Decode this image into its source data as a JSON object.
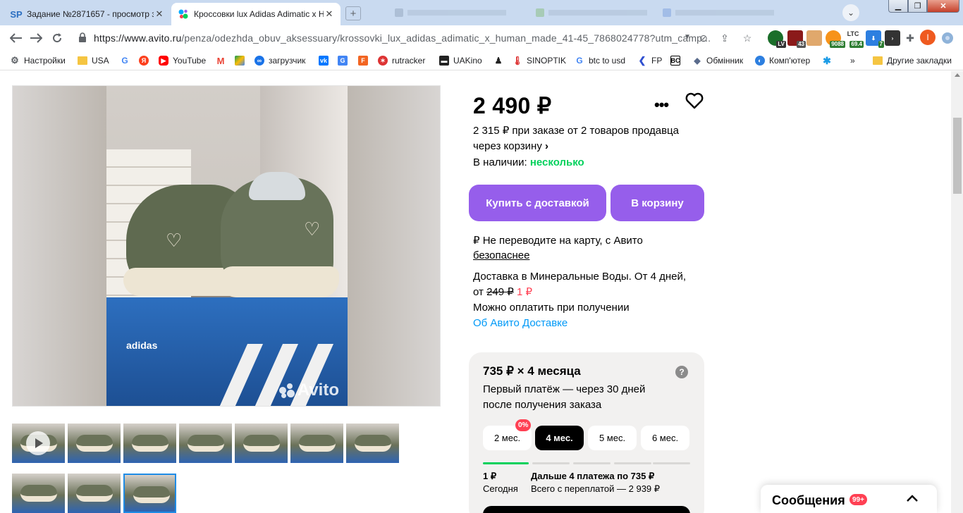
{
  "browser": {
    "tabs": [
      {
        "favicon": "SP",
        "title": "Задание №2871657 - просмотр з"
      },
      {
        "favicon": "avito-icon",
        "title": "Кроссовки lux Adidas Adimatic x H"
      }
    ],
    "url_main": "https://www.avito.ru",
    "url_rest": "/penza/odezhda_obuv_aksessuary/krossovki_lux_adidas_adimatic_x_human_made_41-45_7868024778?utm_camp...",
    "extensions": {
      "lv": "LV",
      "count43": "43",
      "btc": "9088",
      "ltc_label": "LTC",
      "ltc_value": "69.4",
      "dl": "7"
    },
    "profile_letter": "I",
    "bookmarks": [
      {
        "label": "Настройки",
        "icon": "gear-icon"
      },
      {
        "label": "USA",
        "icon": "folder-icon"
      },
      {
        "label": "",
        "icon": "google-icon"
      },
      {
        "label": "",
        "icon": "yandex-icon"
      },
      {
        "label": "YouTube",
        "icon": "youtube-icon"
      },
      {
        "label": "",
        "icon": "gmail-icon"
      },
      {
        "label": "",
        "icon": "drive-icon"
      },
      {
        "label": "загрузчик",
        "icon": "loader-icon"
      },
      {
        "label": "",
        "icon": "vk-icon"
      },
      {
        "label": "",
        "icon": "translate-icon"
      },
      {
        "label": "",
        "icon": "fcorp-icon"
      },
      {
        "label": "rutracker",
        "icon": "rutracker-icon"
      },
      {
        "label": "UAKino",
        "icon": "uakino-icon"
      },
      {
        "label": "",
        "icon": "user-icon"
      },
      {
        "label": "SINOPTIK",
        "icon": "thermometer-icon"
      },
      {
        "label": "btc to usd",
        "icon": "google-icon"
      },
      {
        "label": "FP",
        "icon": "fp-icon"
      },
      {
        "label": "",
        "icon": "bc-icon"
      },
      {
        "label": "Обмінник",
        "icon": "exchange-icon"
      },
      {
        "label": "Комп'ютер",
        "icon": "computer-icon"
      },
      {
        "label": "",
        "icon": "star-icon"
      },
      {
        "label": "»",
        "icon": "more-icon"
      },
      {
        "label": "Другие закладки",
        "icon": "folder-icon"
      }
    ]
  },
  "listing": {
    "watermark": "Avito",
    "price": "2 490 ₽",
    "deal_line1": "2 315 ₽ при заказе от 2 товаров продавца",
    "deal_line2": "через корзину",
    "stock_label": "В наличии:",
    "stock_value": "несколько",
    "buy_button": "Купить с доставкой",
    "cart_button": "В корзину",
    "safe_line1": "₽ Не переводите на карту, с Авито",
    "safe_line2": "безопаснее",
    "delivery_line1": "Доставка в Минеральные Воды. От 4 дней,",
    "delivery_from": "от",
    "delivery_old_price": "249 ₽",
    "delivery_new_price": "1 ₽",
    "pay_on_receipt": "Можно оплатить при получении",
    "delivery_link": "Об Авито Доставке",
    "installment": {
      "title": "735 ₽ × 4 месяца",
      "help": "?",
      "subtitle_line1": "Первый платёж — через 30 дней",
      "subtitle_line2": "после получения заказа",
      "options": [
        "2 мес.",
        "4 мес.",
        "5 мес.",
        "6 мес."
      ],
      "selected": "4 мес.",
      "zero_badge": "0%",
      "first_amount": "1 ₽",
      "first_when": "Сегодня",
      "rest_title": "Дальше 4 платежа по 735 ₽",
      "rest_total": "Всего с переплатой — 2 939 ₽"
    }
  },
  "messages": {
    "label": "Сообщения",
    "count": "99+"
  },
  "colors": {
    "accent": "#965eeb",
    "green": "#02d15c",
    "red": "#ff4053",
    "link": "#0099f7"
  }
}
